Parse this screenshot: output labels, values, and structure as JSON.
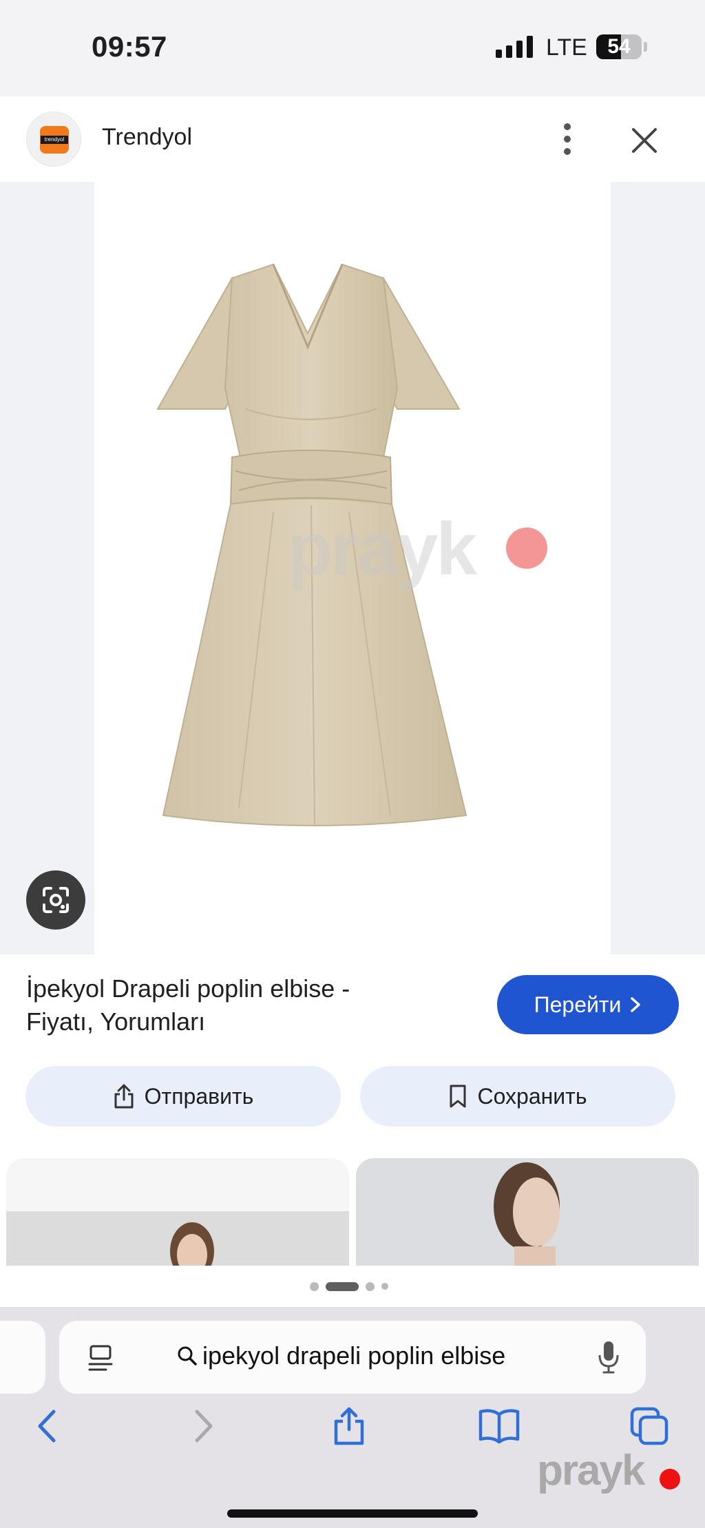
{
  "status_bar": {
    "time": "09:57",
    "network": "LTE",
    "battery": "54",
    "battery_level": 0.54
  },
  "site_header": {
    "site_name": "Trendyol",
    "logo_text": "trendyol"
  },
  "image_viewer": {
    "watermark": "prayk"
  },
  "product": {
    "title": "İpekyol Drapeli poplin elbise - Fiyatı, Yorumları",
    "goto_label": "Перейти"
  },
  "actions": {
    "send_label": "Отправить",
    "save_label": "Сохранить"
  },
  "pager": {
    "count": 4,
    "active": 1
  },
  "browser": {
    "search_text": "ipekyol drapeli poplin elbise"
  },
  "watermark_corner": "prayk",
  "colors": {
    "primary_button": "#1f55d0",
    "secondary_button": "#e9eefb",
    "accent_red": "#e11",
    "dress": "#d9ccb2"
  }
}
